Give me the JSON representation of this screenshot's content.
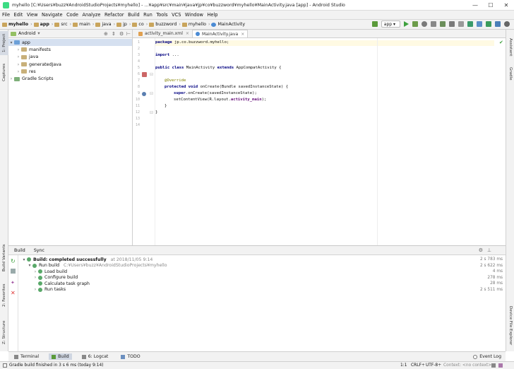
{
  "window": {
    "title": "myhello [C:¥Users¥buzz¥AndroidStudioProjects¥myhello] - ...¥app¥src¥main¥java¥jp¥co¥buzzword¥myhello¥MainActivity.java [app] - Android Studio"
  },
  "menu": [
    "File",
    "Edit",
    "View",
    "Navigate",
    "Code",
    "Analyze",
    "Refactor",
    "Build",
    "Run",
    "Tools",
    "VCS",
    "Window",
    "Help"
  ],
  "breadcrumbs": [
    "myhello",
    "app",
    "src",
    "main",
    "java",
    "jp",
    "co",
    "buzzword",
    "myhello",
    "MainActivity"
  ],
  "toolbar": {
    "run_config": "app"
  },
  "project": {
    "view": "Android",
    "tree": [
      {
        "label": "app",
        "level": 0,
        "open": true,
        "selected": true
      },
      {
        "label": "manifests",
        "level": 1,
        "open": false
      },
      {
        "label": "java",
        "level": 1,
        "open": false
      },
      {
        "label": "generatedJava",
        "level": 1,
        "open": false
      },
      {
        "label": "res",
        "level": 1,
        "open": false
      },
      {
        "label": "Gradle Scripts",
        "level": 0,
        "open": false
      }
    ]
  },
  "editor": {
    "tabs": [
      {
        "label": "activity_main.xml",
        "active": false
      },
      {
        "label": "MainActivity.java",
        "active": true
      }
    ],
    "lines": [
      "1",
      "2",
      "3",
      "4",
      "5",
      "6",
      "7",
      "8",
      "9",
      "10",
      "11",
      "12",
      "13",
      "14"
    ]
  },
  "code": {
    "l1_kw": "package",
    "l1_rest": " jp.co.buzzword.myhello;",
    "l3_kw": "import",
    "l3_rest": " ...",
    "l6_kw1": "public class",
    "l6_mid": " MainActivity ",
    "l6_kw2": "extends",
    "l6_rest": " AppCompatActivity {",
    "l9_ann": "@Override",
    "l10_kw": "protected void",
    "l10_rest": " onCreate(Bundle savedInstanceState) {",
    "l11_kw": "super",
    "l11_rest": ".onCreate(savedInstanceState);",
    "l12_pre": "setContentView(R.layout.",
    "l12_str": "activity_main",
    "l12_post": ");",
    "l13": "}",
    "l14": "}"
  },
  "build": {
    "tabs": [
      "Build",
      "Sync"
    ],
    "rows": [
      {
        "label": "Build: completed successfully",
        "extra": "at 2018/11/05 9:14",
        "time": "2 s 783 ms",
        "level": 0
      },
      {
        "label": "Run build",
        "extra": "C:¥Users¥buzz¥AndroidStudioProjects¥myhello",
        "time": "2 s 622 ms",
        "level": 1
      },
      {
        "label": "Load build",
        "extra": "",
        "time": "4 ms",
        "level": 2
      },
      {
        "label": "Configure build",
        "extra": "",
        "time": "278 ms",
        "level": 2
      },
      {
        "label": "Calculate task graph",
        "extra": "",
        "time": "28 ms",
        "level": 2
      },
      {
        "label": "Run tasks",
        "extra": "",
        "time": "2 s 511 ms",
        "level": 2
      }
    ]
  },
  "left_tabs": [
    "1: Project",
    "Captures",
    "Build Variants",
    "2: Favorites",
    "Z: Structure"
  ],
  "right_tabs": [
    "Assistant",
    "Gradle",
    "Device File Explorer"
  ],
  "bottom_tabs": [
    "Terminal",
    "Build",
    "6: Logcat",
    "TODO"
  ],
  "event_log": "Event Log",
  "status": {
    "message": "Gradle build finished in 3 s 6 ms (today 9:14)",
    "position": "1:1",
    "line_sep": "CRLF÷",
    "encoding": "UTF-8÷",
    "context": "Context: <no context>"
  }
}
